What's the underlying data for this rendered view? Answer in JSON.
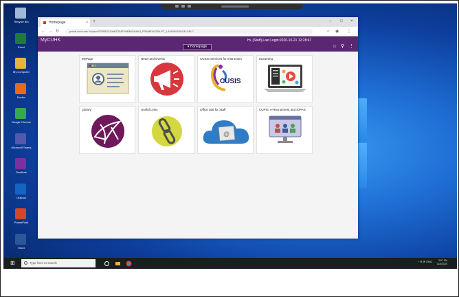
{
  "desktop_icons": [
    {
      "label": "Recycle Bin",
      "color": "#9fb8d8",
      "icon": "recycle-bin-icon"
    },
    {
      "label": "Excel",
      "color": "#1e7a3f",
      "icon": "excel-icon"
    },
    {
      "label": "My Computer",
      "color": "#e4b63a",
      "icon": "folder-icon"
    },
    {
      "label": "Firefox",
      "color": "#e76a1c",
      "icon": "firefox-icon"
    },
    {
      "label": "Google Chrome",
      "color": "#34a853",
      "icon": "chrome-icon"
    },
    {
      "label": "Microsoft Teams",
      "color": "#5558af",
      "icon": "teams-icon"
    },
    {
      "label": "OneNote",
      "color": "#7b2fa3",
      "icon": "onenote-icon"
    },
    {
      "label": "Outlook",
      "color": "#1565c0",
      "icon": "outlook-icon"
    },
    {
      "label": "PowerPoint",
      "color": "#d24726",
      "icon": "powerpoint-icon"
    },
    {
      "label": "Word",
      "color": "#2b579a",
      "icon": "word-icon"
    }
  ],
  "browser": {
    "tab_title": "Homepage",
    "url": "portal.cuhk.edu.hk/psc/EPPRD/CUHKSTAFF/HRMS/c/NUI_FRAMEWORK.PT_LANDINGPAGE.GBL?",
    "new_tab": "+",
    "min": "–",
    "max": "□",
    "close": "×"
  },
  "header": {
    "logo": "MyCUHK",
    "homepage_button": "▾ Homepage",
    "user_text": "Hi,                   (Staff),Last Login:2020-10-21 12:28:47"
  },
  "tiles": [
    {
      "label": "MyPage"
    },
    {
      "label": "News and Events"
    },
    {
      "label": "CUSIS Services for Instructors"
    },
    {
      "label": "eLearning"
    },
    {
      "label": "Library"
    },
    {
      "label": "Useful Links"
    },
    {
      "label": "Office 365 for Staff"
    },
    {
      "label": "CUPIS, e-Recruitment and iOPAS"
    }
  ],
  "cusis_logo_text": "CUSIS",
  "taskbar": {
    "search_placeholder": "Type here to search",
    "tray": "^  ⊕  ✉  ENG",
    "clock_time": "3:57 PM",
    "clock_date": "11/4/2020"
  }
}
